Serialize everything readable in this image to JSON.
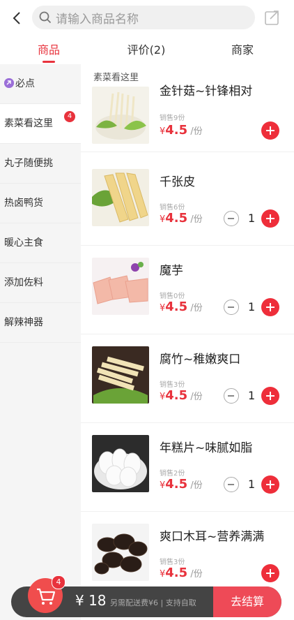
{
  "search": {
    "placeholder": "请输入商品名称"
  },
  "tabs": [
    {
      "label": "商品",
      "active": true
    },
    {
      "label": "评价(2)",
      "active": false
    },
    {
      "label": "商家",
      "active": false
    }
  ],
  "sidebar": {
    "items": [
      {
        "label": "必点",
        "icon": "must-icon"
      },
      {
        "label": "素菜看这里",
        "badge": "4",
        "active": true
      },
      {
        "label": "丸子随便挑"
      },
      {
        "label": "热卤鸭货"
      },
      {
        "label": "暖心主食"
      },
      {
        "label": "添加佐料"
      },
      {
        "label": "解辣神器"
      }
    ]
  },
  "section_title": "素菜看这里",
  "products": [
    {
      "name": "金针菇~针锋相对",
      "sold": "销售9份",
      "price_prefix": "¥",
      "price": "4.5",
      "unit": "/份",
      "qty": null
    },
    {
      "name": "千张皮",
      "sold": "销售6份",
      "price_prefix": "¥",
      "price": "4.5",
      "unit": "/份",
      "qty": "1"
    },
    {
      "name": "魔芋",
      "sold": "销售0份",
      "price_prefix": "¥",
      "price": "4.5",
      "unit": "/份",
      "qty": "1"
    },
    {
      "name": "腐竹~稚嫩爽口",
      "sold": "销售3份",
      "price_prefix": "¥",
      "price": "4.5",
      "unit": "/份",
      "qty": "1"
    },
    {
      "name": "年糕片~味腻如脂",
      "sold": "销售2份",
      "price_prefix": "¥",
      "price": "4.5",
      "unit": "/份",
      "qty": "1"
    },
    {
      "name": "爽口木耳~营养满满",
      "sold": "销售3份",
      "price_prefix": "¥",
      "price": "4.5",
      "unit": "/份",
      "qty": null
    }
  ],
  "cart": {
    "badge": "4",
    "total": "¥ 18",
    "fee_text": "另需配送费¥6 | 支持自取",
    "checkout_label": "去结算"
  },
  "colors": {
    "accent": "#e8323c",
    "cart_bar": "#444444"
  }
}
